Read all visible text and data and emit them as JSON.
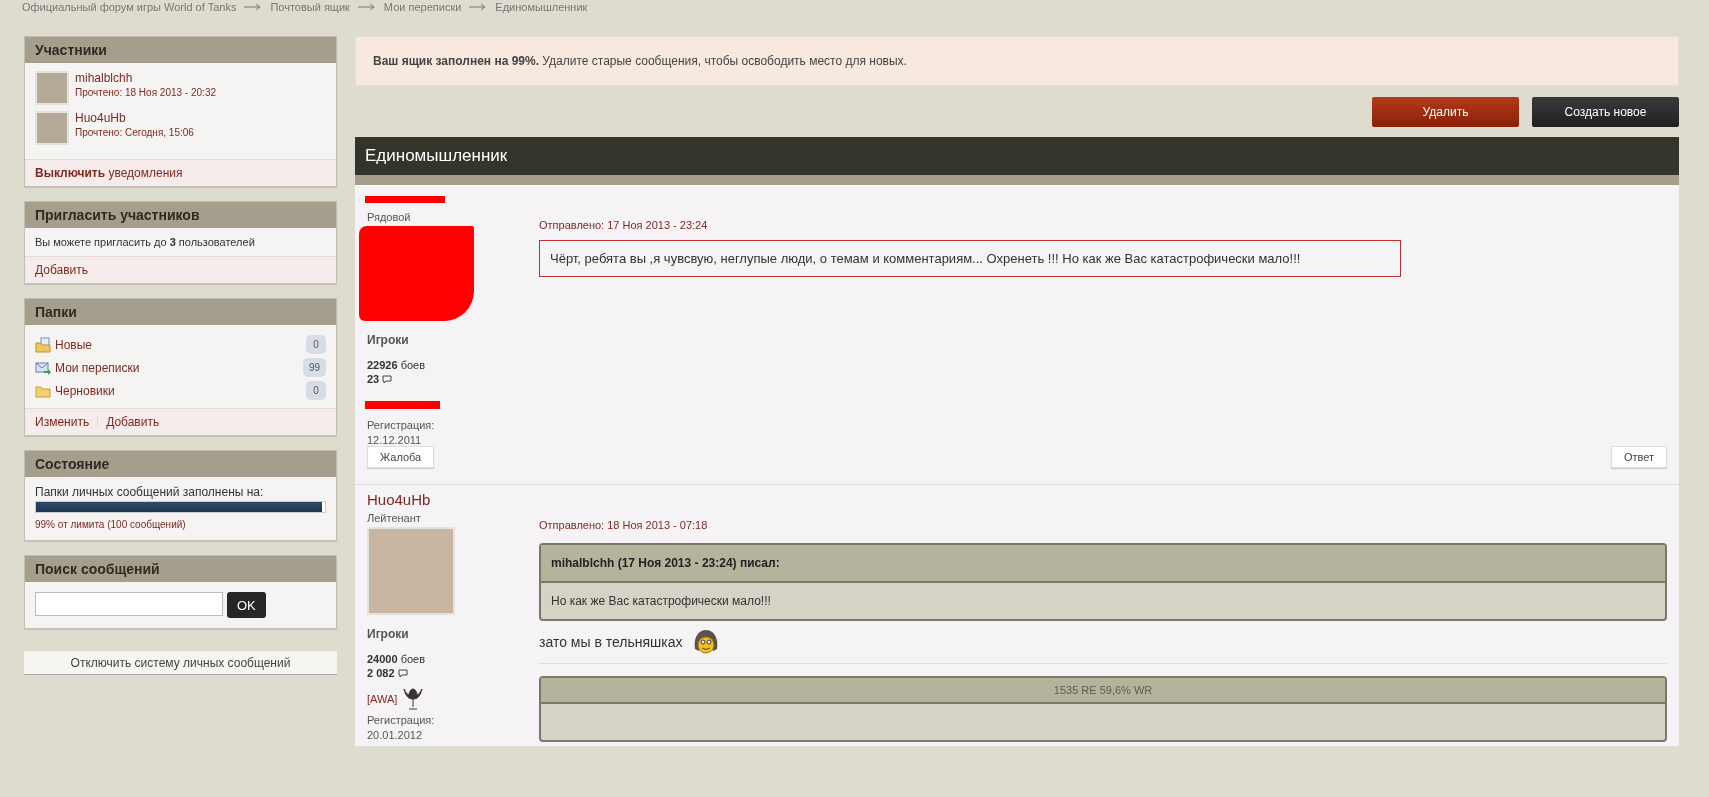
{
  "breadcrumb": [
    "Официальный форум игры World of Tanks",
    "Почтовый ящик",
    "Мои переписки",
    "Единомышленник"
  ],
  "participants": {
    "title": "Участники",
    "members": [
      {
        "name": "mihalblchh",
        "read": "Прочтено: 18 Ноя 2013 - 20:32"
      },
      {
        "name": "Huo4uHb",
        "read": "Прочтено: Сегодня, 15:06"
      }
    ],
    "notify": "**Выключить** уведомления"
  },
  "invite": {
    "title": "Пригласить участников",
    "text": "Вы можете пригласить до **3** пользователей",
    "add": "Добавить"
  },
  "folders": {
    "title": "Папки",
    "items": [
      {
        "name": "Новые",
        "count": "0",
        "kind": "new"
      },
      {
        "name": "Мои переписки",
        "count": "99",
        "kind": "mail"
      },
      {
        "name": "Черновики",
        "count": "0",
        "kind": "drafts"
      }
    ],
    "actions": [
      "Изменить",
      "Добавить"
    ]
  },
  "status": {
    "title": "Состояние",
    "label": "Папки личных сообщений заполнены на:",
    "level": 0.99,
    "note": "99% от лимита (100 сообщений)"
  },
  "search": {
    "title": "Поиск сообщений",
    "button": "OK"
  },
  "disable_button": "Отключить систему личных сообщений",
  "alert": "**Ваш ящик заполнен на 99%.** Удалите старые сообщения, чтобы освободить место для новых.",
  "actions": [
    {
      "label": "Удалить",
      "kind": "danger"
    },
    {
      "label": "Создать новое",
      "kind": "dark"
    }
  ],
  "topic_title": "Единомышленник",
  "posts": [
    {
      "redacted": true,
      "rank": "Рядовой",
      "group": "Игроки",
      "battles": "22926",
      "battles_label": "боев",
      "posts_count": "23",
      "reg_label": "Регистрация:",
      "reg_date": "12.12.2011",
      "sent": "Отправлено: 17 Ноя 2013 - 23:24",
      "blocks": [
        {
          "kind": "boxed",
          "text": "Чёрт, ребята вы ,я чувсвую, неглупые люди, о темам и комментариям... Охренеть !!! Но как же Вас катастрофически мало!!!"
        }
      ],
      "buttons": [
        "Жалоба",
        "Ответ"
      ]
    },
    {
      "redacted": false,
      "author": "Huo4uHb",
      "rank": "Лейтенант",
      "group": "Игроки",
      "battles": "24000",
      "battles_label": "боев",
      "posts_count": "2  082",
      "clan": "[AWA]",
      "reg_label": "Регистрация:",
      "reg_date": "20.01.2012",
      "sent": "Отправлено: 18 Ноя 2013 - 07:18",
      "blocks": [
        {
          "kind": "quote",
          "header": "mihalblchh (17 Ноя 2013 - 23:24) писал:",
          "text": "Но как же Вас катастрофически мало!!!"
        },
        {
          "kind": "text",
          "text": "зато мы в тельняшках",
          "emoticon": true
        },
        {
          "kind": "signature",
          "text": "1535 RE 59,6% WR"
        }
      ]
    }
  ]
}
